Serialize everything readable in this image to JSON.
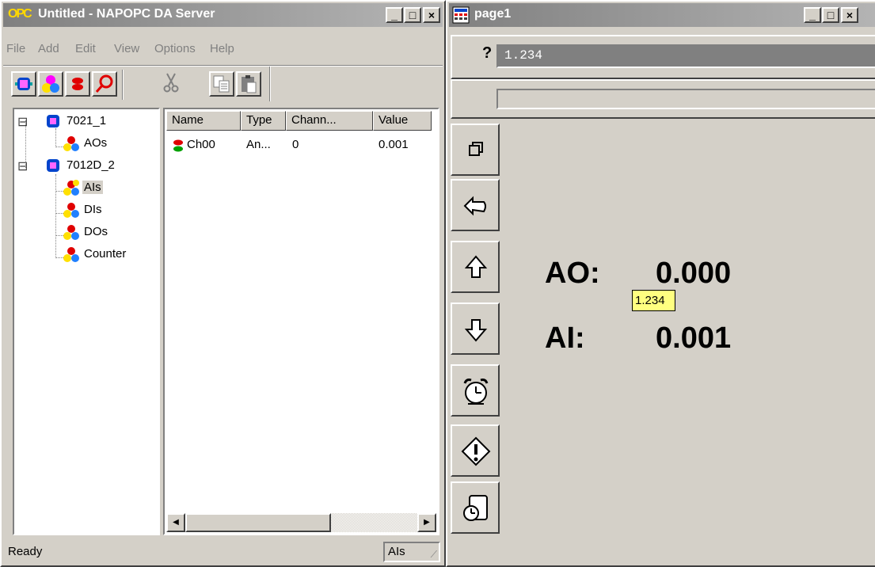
{
  "left_window": {
    "title": "Untitled - NAPOPC DA Server",
    "logo": "OPC",
    "menu": [
      "File",
      "Add",
      "Edit",
      "View",
      "Options",
      "Help"
    ],
    "toolbar_icons": [
      "add-device-icon",
      "add-group-icon",
      "add-tag-icon",
      "search-icon",
      "cut-icon",
      "copy-icon",
      "paste-icon"
    ],
    "tree": [
      {
        "label": "7021_1",
        "expander": "⊟",
        "level": 0
      },
      {
        "label": "AOs",
        "level": 1
      },
      {
        "label": "7012D_2",
        "expander": "⊟",
        "level": 0
      },
      {
        "label": "AIs",
        "level": 1,
        "selected": true
      },
      {
        "label": "DIs",
        "level": 1
      },
      {
        "label": "DOs",
        "level": 1
      },
      {
        "label": "Counter",
        "level": 1
      }
    ],
    "list": {
      "columns": [
        "Name",
        "Type",
        "Chann...",
        "Value"
      ],
      "rows": [
        {
          "name": "Ch00",
          "type": "An...",
          "channel": "0",
          "value": "0.001"
        }
      ]
    },
    "status": {
      "text": "Ready",
      "pane": "AIs"
    }
  },
  "right_window": {
    "title": "page1",
    "input_prefix": "?",
    "input_value": "1.234",
    "side_buttons": [
      "window-icon",
      "back-arrow-icon",
      "up-arrow-icon",
      "down-arrow-icon",
      "alarm-clock-icon",
      "warning-icon",
      "report-icon"
    ],
    "ao_label": "AO:",
    "ao_value": "0.000",
    "ai_label": "AI:",
    "ai_value": "0.001",
    "tooltip": "1.234"
  },
  "colors": {
    "face": "#d4d0c8",
    "title_inactive": "#808080",
    "tooltip": "#ffff80",
    "input_bg": "#808080"
  }
}
